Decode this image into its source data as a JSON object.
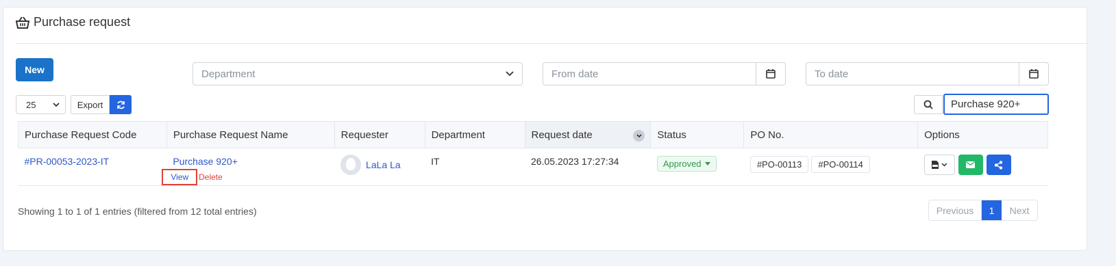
{
  "page": {
    "title": "Purchase request",
    "new_label": "New",
    "department_placeholder": "Department",
    "from_date_placeholder": "From date",
    "to_date_placeholder": "To date",
    "page_size": "25",
    "export_label": "Export",
    "search_value": "Purchase 920+"
  },
  "table": {
    "headers": [
      "Purchase Request Code",
      "Purchase Request Name",
      "Requester",
      "Department",
      "Request date",
      "Status",
      "PO No.",
      "Options"
    ],
    "rows": [
      {
        "code": "#PR-00053-2023-IT",
        "name": "Purchase 920+",
        "view": "View",
        "delete": "Delete",
        "requester": "LaLa La",
        "department": "IT",
        "date": "26.05.2023 17:27:34",
        "status": "Approved",
        "po": [
          "#PO-00113",
          "#PO-00114"
        ]
      }
    ]
  },
  "footer": {
    "info": "Showing 1 to 1 of 1 entries (filtered from 12 total entries)",
    "previous": "Previous",
    "current": "1",
    "next": "Next"
  },
  "colors": {
    "primary": "#2465e0",
    "new_button": "#1a73c9",
    "success": "#22b868",
    "danger": "#e0413a"
  }
}
